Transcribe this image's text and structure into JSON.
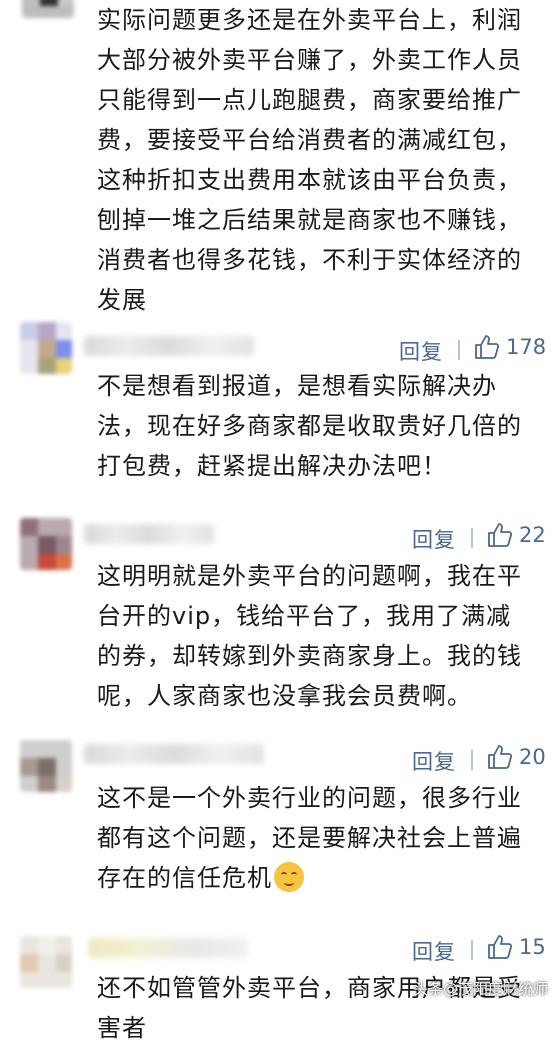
{
  "comments": [
    {
      "text_lines": [
        "实际问题更多还是在外卖平台上，利润",
        "大部分被外卖平台赚了，外卖工作人员",
        "只能得到一点儿跑腿费，商家要给推广",
        "费，要接受平台给消费者的满减红包，",
        "这种折扣支出费用本就该由平台负责，",
        "刨掉一堆之后结果就是商家也不赚钱，",
        "消费者也得多花钱，不利于实体经济的",
        "发展"
      ]
    },
    {
      "reply_label": "回复",
      "likes": "178",
      "text_lines": [
        "不是想看到报道，是想看实际解决办",
        "法，现在好多商家都是收取贵好几倍的",
        "打包费，赶紧提出解决办法吧！"
      ]
    },
    {
      "reply_label": "回复",
      "likes": "22",
      "text_lines": [
        "这明明就是外卖平台的问题啊，我在平",
        "台开的vip，钱给平台了，我用了满减",
        "的券，却转嫁到外卖商家身上。我的钱",
        "呢，人家商家也没拿我会员费啊。"
      ]
    },
    {
      "reply_label": "回复",
      "likes": "20",
      "text_lines": [
        "这不是一个外卖行业的问题，很多行业",
        "都有这个问题，还是要解决社会上普遍",
        "存在的信任危机"
      ]
    },
    {
      "reply_label": "回复",
      "likes": "15",
      "text_lines": [
        "还不如管管外卖平台，商家用户都是受",
        "害者"
      ]
    }
  ],
  "watermark": "头条@茂阳度财统师",
  "colors": {
    "link": "#4a6891",
    "text": "#1a1a1a"
  },
  "icons": {
    "like": "thumbs-up-icon",
    "emoji": "smiling-face-icon"
  }
}
